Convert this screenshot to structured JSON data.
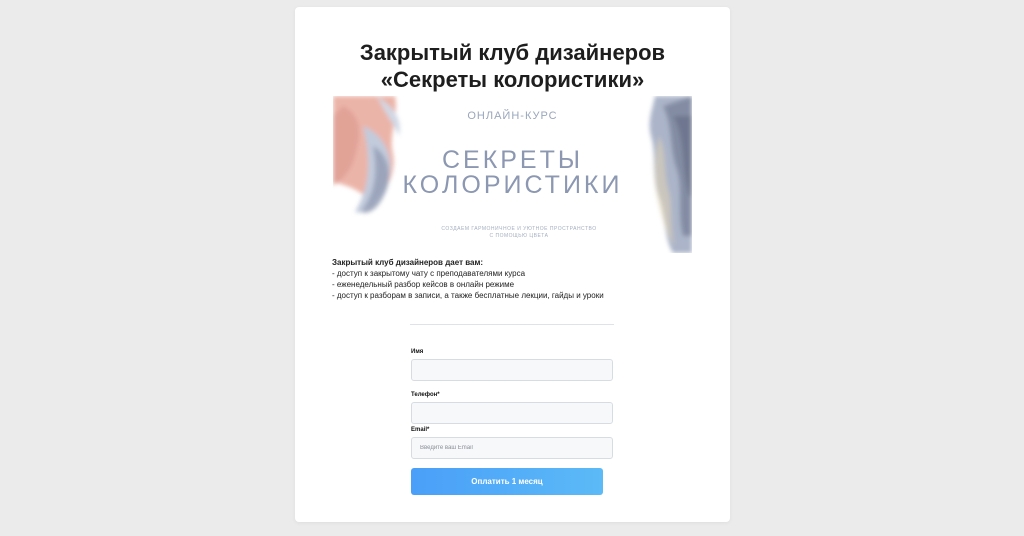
{
  "page": {
    "title": "Закрытый клуб дизайнеров «Секреты колористики»"
  },
  "banner": {
    "kicker": "ОНЛАЙН-КУРС",
    "title_line1": "СЕКРЕТЫ",
    "title_line2": "КОЛОРИСТИКИ",
    "subtitle": "СОЗДАЕМ ГАРМОНИЧНОЕ И УЮТНОЕ ПРОСТРАНСТВО С ПОМОЩЬЮ ЦВЕТА"
  },
  "benefits": {
    "heading": "Закрытый клуб дизайнеров дает вам:",
    "items": [
      "- доступ к закрытому чату с преподавателями курса",
      "- еженедельный разбор кейсов в онлайн режиме",
      "- доступ к разборам в записи, а также бесплатные лекции, гайды и уроки"
    ]
  },
  "form": {
    "name_label": "Имя",
    "name_value": "",
    "phone_label": "Телефон*",
    "phone_value": "",
    "email_label": "Email*",
    "email_placeholder": "Введите ваш Email",
    "submit_label": "Оплатить 1 месяц"
  },
  "colors": {
    "page_background": "#ebebeb",
    "card_background": "#ffffff",
    "button_gradient_start": "#4a9ff8",
    "button_gradient_end": "#5cbaf7",
    "banner_text": "#8c98b2"
  }
}
